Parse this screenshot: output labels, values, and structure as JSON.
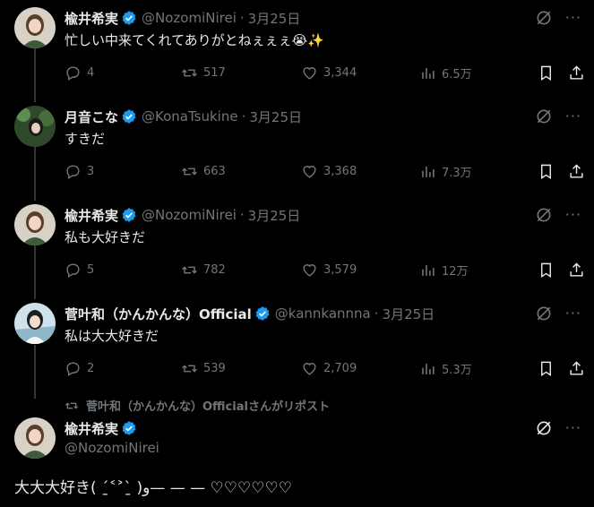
{
  "tweets": [
    {
      "name": "楡井希実",
      "handle": "@NozomiNirei",
      "time": "3月25日",
      "text": "忙しい中来てくれてありがとねぇぇぇ😭✨",
      "replies": "4",
      "reposts": "517",
      "likes": "3,344",
      "views": "6.5万"
    },
    {
      "name": "月音こな",
      "handle": "@KonaTsukine",
      "time": "3月25日",
      "text": "すきだ",
      "replies": "3",
      "reposts": "663",
      "likes": "3,368",
      "views": "7.3万"
    },
    {
      "name": "楡井希実",
      "handle": "@NozomiNirei",
      "time": "3月25日",
      "text": "私も大好きだ",
      "replies": "5",
      "reposts": "782",
      "likes": "3,579",
      "views": "12万"
    },
    {
      "name": "菅叶和（かんかんな）Official",
      "handle": "@kannkannna",
      "time": "3月25日",
      "text": "私は大大好きだ",
      "replies": "2",
      "reposts": "539",
      "likes": "2,709",
      "views": "5.3万"
    }
  ],
  "repost_label": "菅叶和（かんかんな）Officialさんがリポスト",
  "main_tweet": {
    "name": "楡井希実",
    "handle": "@NozomiNirei",
    "text": "大大大好き( ˊ̱˂˃ˋ̱ )و— — — ♡♡♡♡♡♡"
  },
  "dot": "·",
  "more": "···",
  "colors": {
    "background": "#000000",
    "text": "#e7e9ea",
    "muted": "#71767b",
    "verified": "#1d9bf0"
  }
}
